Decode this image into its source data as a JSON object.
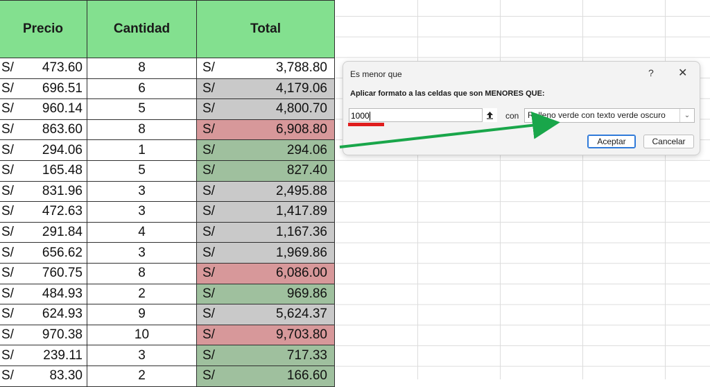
{
  "sheet": {
    "headers": {
      "precio": "Precio",
      "cantidad": "Cantidad",
      "total": "Total"
    },
    "currency": "S/",
    "rows": [
      {
        "precio": "473.60",
        "cantidad": "8",
        "total": "3,788.80",
        "fmt": "none"
      },
      {
        "precio": "696.51",
        "cantidad": "6",
        "total": "4,179.06",
        "fmt": "gray"
      },
      {
        "precio": "960.14",
        "cantidad": "5",
        "total": "4,800.70",
        "fmt": "gray"
      },
      {
        "precio": "863.60",
        "cantidad": "8",
        "total": "6,908.80",
        "fmt": "red"
      },
      {
        "precio": "294.06",
        "cantidad": "1",
        "total": "294.06",
        "fmt": "green"
      },
      {
        "precio": "165.48",
        "cantidad": "5",
        "total": "827.40",
        "fmt": "green"
      },
      {
        "precio": "831.96",
        "cantidad": "3",
        "total": "2,495.88",
        "fmt": "gray"
      },
      {
        "precio": "472.63",
        "cantidad": "3",
        "total": "1,417.89",
        "fmt": "gray"
      },
      {
        "precio": "291.84",
        "cantidad": "4",
        "total": "1,167.36",
        "fmt": "gray"
      },
      {
        "precio": "656.62",
        "cantidad": "3",
        "total": "1,969.86",
        "fmt": "gray"
      },
      {
        "precio": "760.75",
        "cantidad": "8",
        "total": "6,086.00",
        "fmt": "red"
      },
      {
        "precio": "484.93",
        "cantidad": "2",
        "total": "969.86",
        "fmt": "green"
      },
      {
        "precio": "624.93",
        "cantidad": "9",
        "total": "5,624.37",
        "fmt": "gray"
      },
      {
        "precio": "970.38",
        "cantidad": "10",
        "total": "9,703.80",
        "fmt": "red"
      },
      {
        "precio": "239.11",
        "cantidad": "3",
        "total": "717.33",
        "fmt": "green"
      },
      {
        "precio": "83.30",
        "cantidad": "2",
        "total": "166.60",
        "fmt": "green"
      }
    ]
  },
  "dialog": {
    "title": "Es menor que",
    "help_icon": "?",
    "close_icon": "✕",
    "instruction": "Aplicar formato a las celdas que son MENORES QUE:",
    "value": "1000",
    "collapse_icon": "upload-arrow-icon",
    "con_label": "con",
    "format_selected": "Relleno verde con texto verde oscuro",
    "ok_label": "Aceptar",
    "cancel_label": "Cancelar"
  },
  "colors": {
    "header_green": "#83e08f",
    "gray_fill": "#c9c9c9",
    "red_fill": "#d7989a",
    "red_text": "#a01418",
    "green_fill": "#9fc09e",
    "green_text": "#1b5e20",
    "annotation_red": "#e01d1d",
    "annotation_green": "#19a64a"
  }
}
